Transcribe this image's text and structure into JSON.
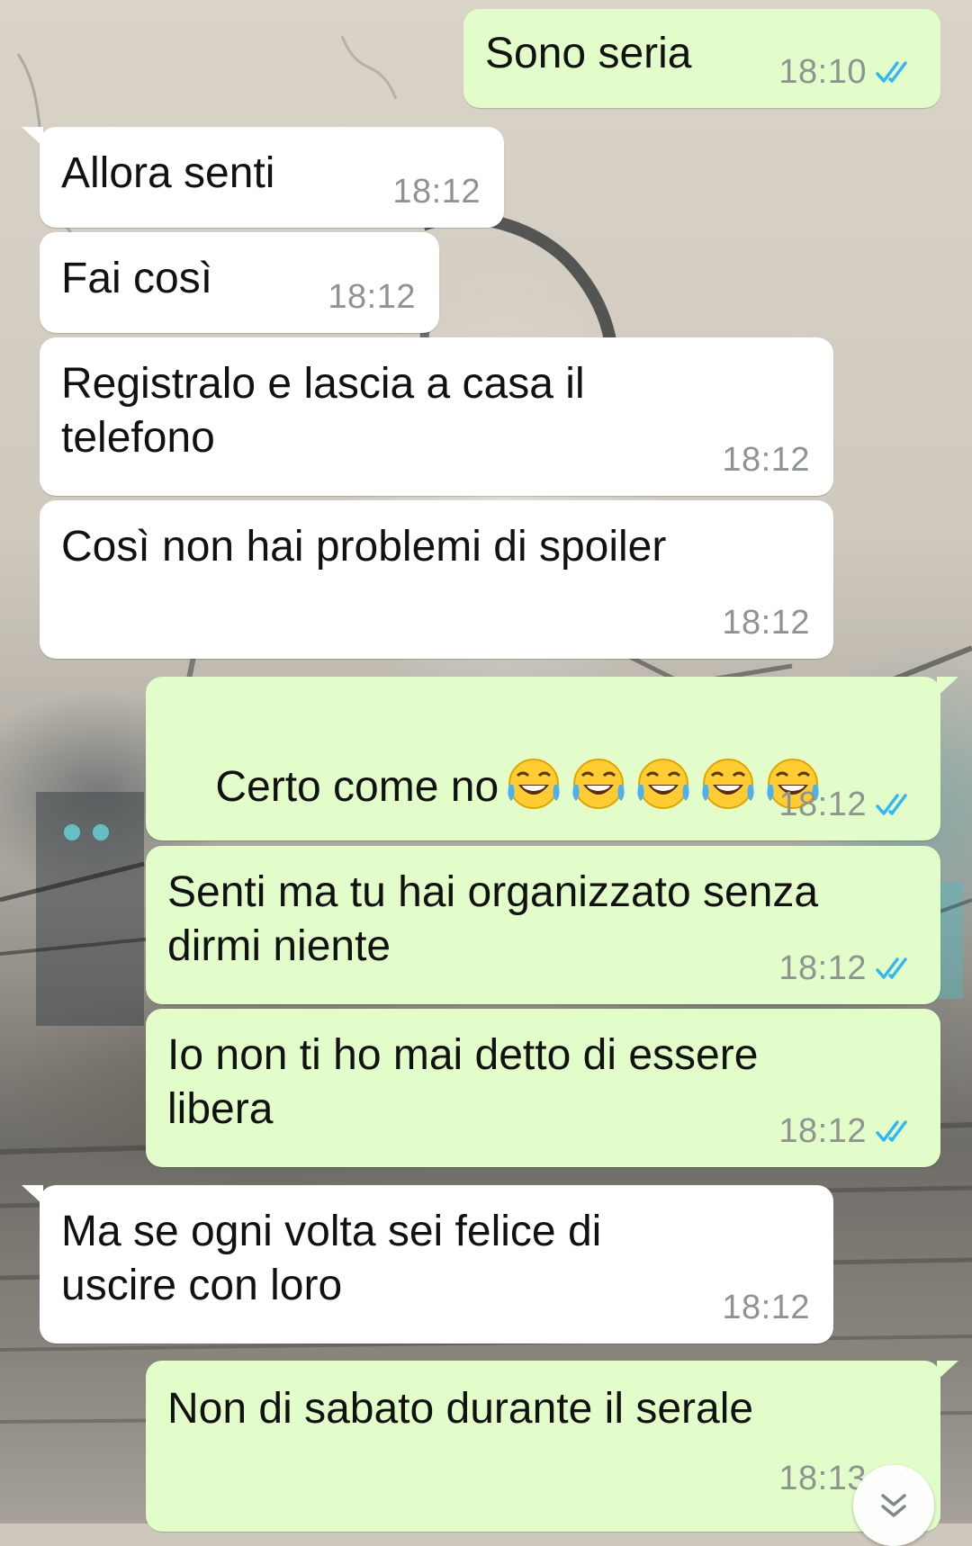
{
  "chat": {
    "messages": [
      {
        "direction": "out",
        "text": "Sono seria",
        "time": "18:10",
        "status": "read"
      },
      {
        "direction": "in",
        "text": "Allora senti",
        "time": "18:12"
      },
      {
        "direction": "in",
        "text": "Fai così",
        "time": "18:12"
      },
      {
        "direction": "in",
        "text": "Registralo e lascia a casa il\ntelefono",
        "time": "18:12"
      },
      {
        "direction": "in",
        "text": "Così non hai problemi di spoiler",
        "time": "18:12"
      },
      {
        "direction": "out",
        "text": "Certo come no",
        "emoji": "face-with-tears-of-joy",
        "emoji_count": 5,
        "time": "18:12",
        "status": "read"
      },
      {
        "direction": "out",
        "text": "Senti ma tu hai organizzato senza\ndirmi niente",
        "time": "18:12",
        "status": "read"
      },
      {
        "direction": "out",
        "text": "Io non ti ho mai detto di essere\nlibera",
        "time": "18:12",
        "status": "read"
      },
      {
        "direction": "in",
        "text": "Ma se ogni volta sei felice di\nuscire con loro",
        "time": "18:12"
      },
      {
        "direction": "out",
        "text": "Non di sabato durante il serale",
        "time": "18:13",
        "status": "read"
      }
    ],
    "scroll_button": {
      "icon": "double-chevron-down-icon"
    }
  },
  "colors": {
    "incoming_bubble": "#ffffff",
    "outgoing_bubble": "#e2fdc9",
    "timestamp": "#8e9590",
    "read_ticks": "#34b7f1",
    "header_strip": "#075e54"
  }
}
